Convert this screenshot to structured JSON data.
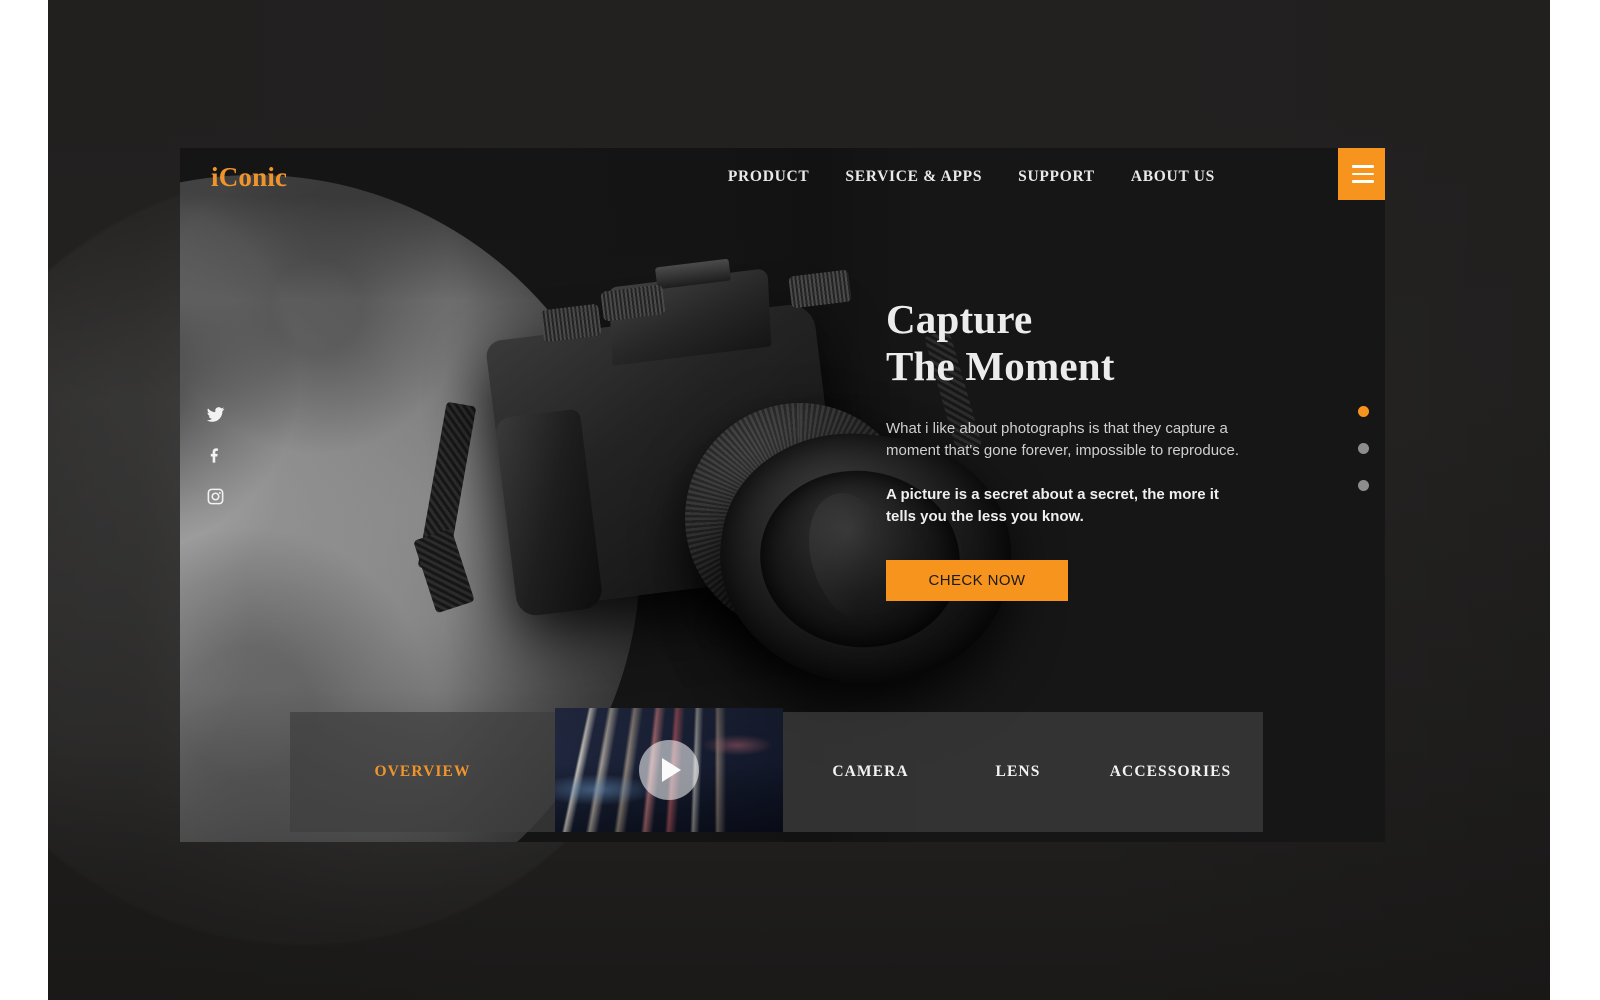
{
  "brand": {
    "logo": "iConic",
    "accent_color": "#f7941e",
    "card_background": "#161616",
    "page_background": "#2b2a29"
  },
  "header": {
    "nav_items": [
      {
        "label": "PRODUCT"
      },
      {
        "label": "SERVICE & APPS"
      },
      {
        "label": "SUPPORT"
      },
      {
        "label": "ABOUT US"
      }
    ],
    "menu_button": {
      "icon": "hamburger-menu-icon"
    }
  },
  "social": [
    {
      "name": "twitter-icon"
    },
    {
      "name": "facebook-icon"
    },
    {
      "name": "instagram-icon"
    }
  ],
  "hero": {
    "title_line1": "Capture",
    "title_line2": "The Moment",
    "paragraph": "What i like about photographs is that they capture a moment that's gone forever, impossible to reproduce.",
    "paragraph_bold": "A picture is a secret about a secret, the more it tells you the less you know.",
    "cta_label": "CHECK NOW",
    "image_alt": "black-dslr-camera-in-front-of-the-moon"
  },
  "carousel": {
    "slides": 3,
    "active_index": 0,
    "active_color": "#f7941e",
    "inactive_color": "#8d8d8d"
  },
  "tabs": [
    {
      "label": "OVERVIEW",
      "active": true
    },
    {
      "label": "CAMERA",
      "active": false
    },
    {
      "label": "LENS",
      "active": false
    },
    {
      "label": "ACCESSORIES",
      "active": false
    }
  ],
  "video": {
    "thumbnail_alt": "night-highway-light-trails",
    "play_icon": "play-icon"
  }
}
